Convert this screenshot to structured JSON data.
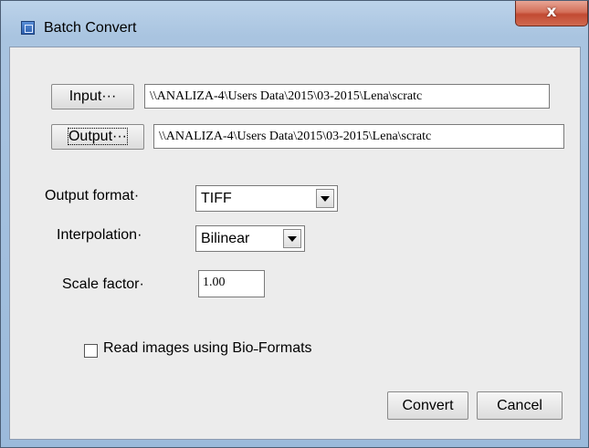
{
  "window": {
    "title": "Batch Convert",
    "close_glyph": "x",
    "colors": {
      "frame": "#9bbadb",
      "close_button": "#c24a33",
      "client": "#ececec"
    }
  },
  "input": {
    "button_label": "Input···",
    "path": "\\\\ANALIZA-4\\Users Data\\2015\\03-2015\\Lena\\scratc"
  },
  "output": {
    "button_label": "Output···",
    "path": "\\\\ANALIZA-4\\Users Data\\2015\\03-2015\\Lena\\scratc"
  },
  "output_format": {
    "label": "Output format·",
    "value": "TIFF"
  },
  "interpolation": {
    "label": "Interpolation·",
    "value": "Bilinear"
  },
  "scale_factor": {
    "label": "Scale factor·",
    "value": "1.00"
  },
  "bioformats": {
    "label": "Read images using Bio˗Formats",
    "checked": false
  },
  "actions": {
    "convert_label": "Convert",
    "cancel_label": "Cancel"
  }
}
